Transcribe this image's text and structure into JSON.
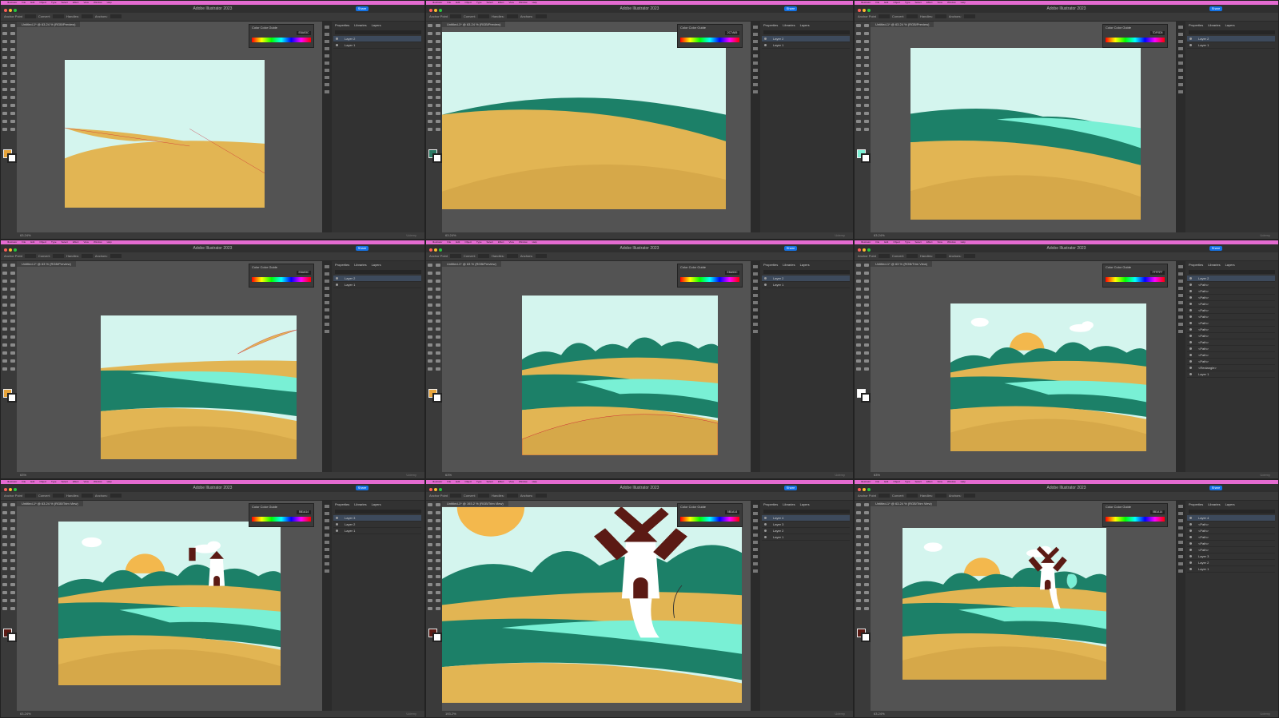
{
  "app": {
    "title": "Adobe Illustrator 2023",
    "menu": [
      "Illustrator",
      "File",
      "Edit",
      "Object",
      "Type",
      "Select",
      "Effect",
      "View",
      "Window",
      "Help"
    ],
    "share_label": "Share"
  },
  "control_bar": {
    "items": [
      "Anchor Point",
      "Convert:",
      "Handles:",
      "Anchors:"
    ]
  },
  "dock": {
    "tabs": [
      "Properties",
      "Libraries",
      "Layers"
    ]
  },
  "color_panel": {
    "tabs": [
      "Color",
      "Color Guide"
    ]
  },
  "colors": {
    "sky": "#d4f5ee",
    "sand": "#e2b553",
    "sand_dark": "#d6a849",
    "teal": "#1c8068",
    "teal_dark": "#186e5a",
    "aqua": "#79f0d5",
    "sun": "#f3b84d",
    "mill_brown": "#5b1a14",
    "ui_bg": "#535353"
  },
  "panels": [
    {
      "id": 1,
      "doc_tab": "Untitled-1* @ 63.24 % (RGB/Preview)",
      "hex": "E8A53C",
      "layers": [
        "Layer 2",
        "Layer 1"
      ],
      "status": "63.24%",
      "brand": "Udemy"
    },
    {
      "id": 2,
      "doc_tab": "Untitled-1* @ 63.24 % (RGB/Preview)",
      "hex": "2C7A65",
      "layers": [
        "Layer 2",
        "Layer 1"
      ],
      "status": "63.24%",
      "brand": "Udemy"
    },
    {
      "id": 3,
      "doc_tab": "Untitled-1* @ 63.24 % (RGB/Preview)",
      "hex": "7DF0D5",
      "layers": [
        "Layer 2",
        "Layer 1"
      ],
      "status": "63.24%",
      "brand": "Udemy"
    },
    {
      "id": 4,
      "doc_tab": "Untitled-1* @ 63 % (RGB/Preview)",
      "hex": "E8A53C",
      "layers": [
        "Layer 2",
        "Layer 1"
      ],
      "status": "63%",
      "brand": "Udemy"
    },
    {
      "id": 5,
      "doc_tab": "Untitled-1* @ 63 % (RGB/Preview)",
      "hex": "E8A53C",
      "layers": [
        "Layer 2",
        "Layer 1"
      ],
      "status": "63%",
      "brand": "Udemy"
    },
    {
      "id": 6,
      "doc_tab": "Untitled-1* @ 63 % (RGB/Trim View)",
      "hex": "FFFFFF",
      "layers": [
        "Layer 2",
        "<Path>",
        "<Path>",
        "<Path>",
        "<Path>",
        "<Path>",
        "<Path>",
        "<Path>",
        "<Path>",
        "<Path>",
        "<Path>",
        "<Path>",
        "<Path>",
        "<Path>",
        "<Rectangle>",
        "Layer 1"
      ],
      "status": "63%",
      "brand": "Udemy"
    },
    {
      "id": 7,
      "doc_tab": "Untitled-1* @ 63.24 % (RGB/Trim View)",
      "hex": "5B1A14",
      "layers": [
        "Layer 3",
        "Layer 2",
        "Layer 1"
      ],
      "status": "63.24%",
      "brand": "Udemy"
    },
    {
      "id": 8,
      "doc_tab": "Untitled-1* @ 193.2 % (RGB/Trim View)",
      "hex": "5B1A14",
      "layers": [
        "Layer 4",
        "Layer 3",
        "Layer 2",
        "Layer 1"
      ],
      "status": "193.2%",
      "brand": "Udemy"
    },
    {
      "id": 9,
      "doc_tab": "Untitled-1* @ 63.24 % (RGB/Trim View)",
      "hex": "5B1A14",
      "layers": [
        "Layer 4",
        "<Path>",
        "<Path>",
        "<Path>",
        "<Path>",
        "<Path>",
        "Layer 3",
        "Layer 2",
        "Layer 1"
      ],
      "status": "63.24%",
      "brand": "Udemy"
    }
  ]
}
